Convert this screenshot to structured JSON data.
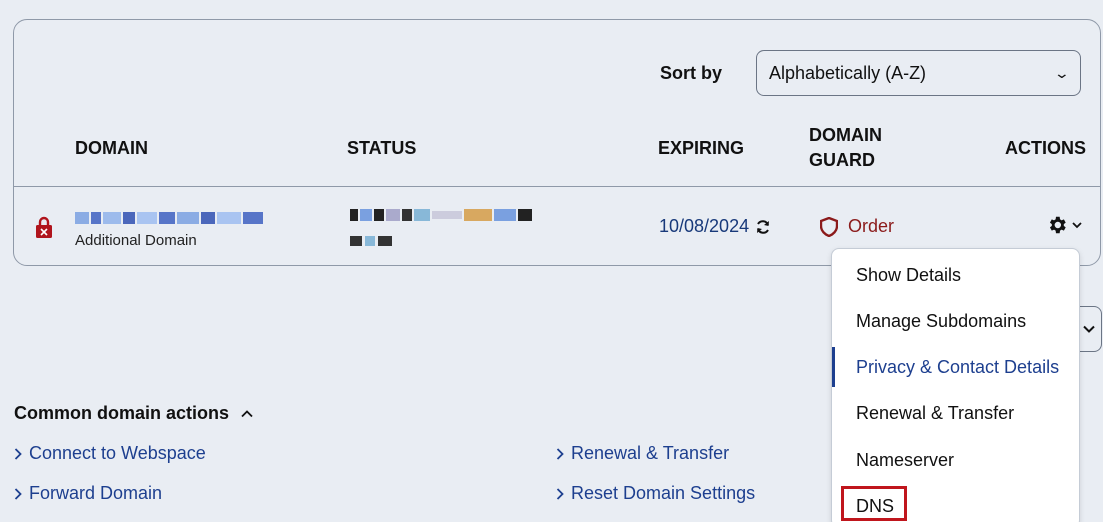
{
  "sort": {
    "label": "Sort by",
    "selected": "Alphabetically (A-Z)"
  },
  "columns": {
    "domain": "DOMAIN",
    "status": "STATUS",
    "expiring": "EXPIRING",
    "guard_line1": "DOMAIN",
    "guard_line2": "GUARD",
    "actions": "ACTIONS"
  },
  "row": {
    "domain_sub": "Additional Domain",
    "expiring": "10/08/2024",
    "guard": "Order"
  },
  "menu": {
    "items": [
      "Show Details",
      "Manage Subdomains",
      "Privacy & Contact Details",
      "Renewal & Transfer",
      "Nameserver",
      "DNS"
    ]
  },
  "common": {
    "title": "Common domain actions",
    "links": [
      "Connect to Webspace",
      "Forward Domain",
      "Renewal & Transfer",
      "Reset Domain Settings"
    ]
  },
  "colors": {
    "accent": "#1d3f8f",
    "guard": "#8b1a1a",
    "lock": "#b0141c",
    "highlight": "#c0161d"
  },
  "icons": [
    "lock-icon",
    "refresh-icon",
    "shield-icon",
    "gear-icon",
    "chevron-down-icon",
    "chevron-up-icon",
    "chevron-right-icon"
  ]
}
